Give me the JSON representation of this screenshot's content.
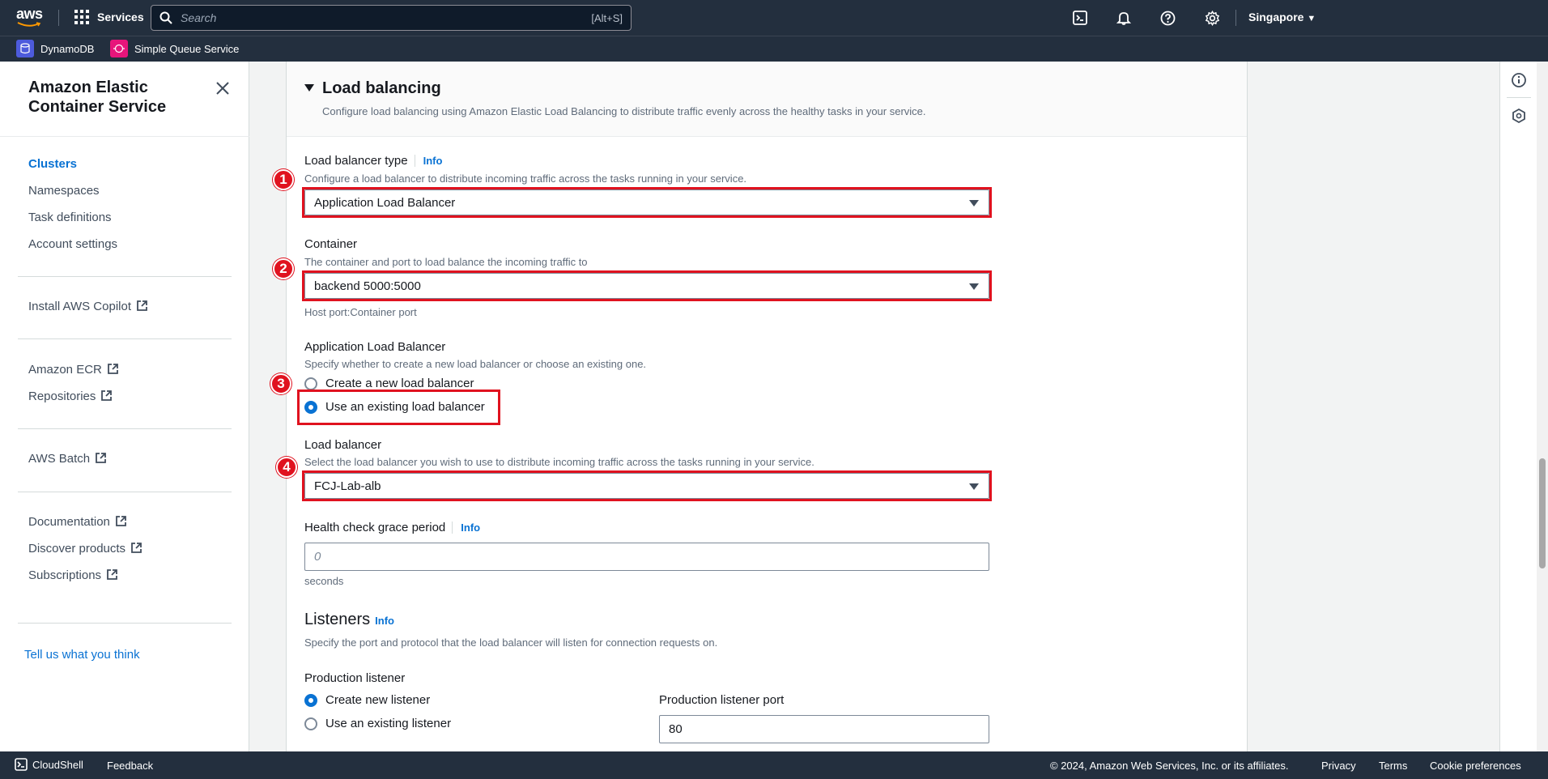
{
  "topnav": {
    "logo_text": "aws",
    "services_label": "Services",
    "search_placeholder": "Search",
    "search_shortcut": "[Alt+S]",
    "region": "Singapore"
  },
  "favorites": [
    {
      "label": "DynamoDB",
      "color": "#4d5bdc"
    },
    {
      "label": "Simple Queue Service",
      "color": "#e7157b"
    }
  ],
  "sidebar": {
    "title": "Amazon Elastic Container Service",
    "group1": [
      "Clusters",
      "Namespaces",
      "Task definitions",
      "Account settings"
    ],
    "install_copilot": "Install AWS Copilot",
    "amazon_ecr": "Amazon ECR",
    "repositories": "Repositories",
    "aws_batch": "AWS Batch",
    "documentation": "Documentation",
    "discover_products": "Discover products",
    "subscriptions": "Subscriptions",
    "feedback_link": "Tell us what you think"
  },
  "panel": {
    "title": "Load balancing",
    "description": "Configure load balancing using Amazon Elastic Load Balancing to distribute traffic evenly across the healthy tasks in your service."
  },
  "info_label": "Info",
  "lb_type": {
    "label": "Load balancer type",
    "description": "Configure a load balancer to distribute incoming traffic across the tasks running in your service.",
    "value": "Application Load Balancer"
  },
  "container": {
    "label": "Container",
    "description": "The container and port to load balance the incoming traffic to",
    "value": "backend 5000:5000",
    "hint": "Host port:Container port"
  },
  "alb": {
    "label": "Application Load Balancer",
    "description": "Specify whether to create a new load balancer or choose an existing one.",
    "option_new": "Create a new load balancer",
    "option_existing": "Use an existing load balancer"
  },
  "load_balancer": {
    "label": "Load balancer",
    "description": "Select the load balancer you wish to use to distribute incoming traffic across the tasks running in your service.",
    "value": "FCJ-Lab-alb"
  },
  "grace": {
    "label": "Health check grace period",
    "placeholder": "0",
    "unit": "seconds"
  },
  "listeners": {
    "heading": "Listeners",
    "description": "Specify the port and protocol that the load balancer will listen for connection requests on.",
    "prod_label": "Production listener",
    "option_new": "Create new listener",
    "option_existing": "Use an existing listener",
    "port_label": "Production listener port",
    "port_value": "80"
  },
  "annotations": [
    "1",
    "2",
    "3",
    "4"
  ],
  "footer": {
    "cloudshell": "CloudShell",
    "feedback": "Feedback",
    "copyright": "© 2024, Amazon Web Services, Inc. or its affiliates.",
    "privacy": "Privacy",
    "terms": "Terms",
    "cookies": "Cookie preferences"
  }
}
